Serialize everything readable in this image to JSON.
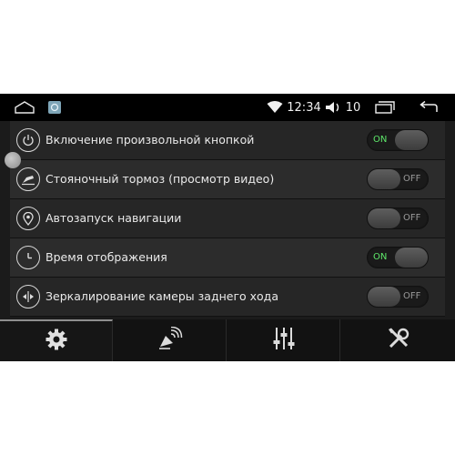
{
  "status_bar": {
    "time": "12:34",
    "volume": "10",
    "icons": [
      "home-outline-icon",
      "app-thumbnail-icon",
      "wifi-icon",
      "volume-icon",
      "recent-apps-icon",
      "back-icon"
    ]
  },
  "settings": [
    {
      "label": "Включение произвольной кнопкой",
      "icon": "power-icon",
      "state": "ON"
    },
    {
      "label": "Стояночный тормоз (просмотр видео)",
      "icon": "parking-brake-icon",
      "state": "OFF"
    },
    {
      "label": "Автозапуск навигации",
      "icon": "location-pin-icon",
      "state": "OFF"
    },
    {
      "label": "Время отображения",
      "icon": "clock-icon",
      "state": "ON"
    },
    {
      "label": "Зеркалирование камеры заднего хода",
      "icon": "mirror-icon",
      "state": "OFF"
    }
  ],
  "tabs": [
    {
      "icon": "gear-icon",
      "active": true
    },
    {
      "icon": "satellite-icon",
      "active": false
    },
    {
      "icon": "equalizer-icon",
      "active": false
    },
    {
      "icon": "tools-icon",
      "active": false
    }
  ],
  "colors": {
    "on_text": "#5ee86a",
    "off_text": "#9a9a9a",
    "background": "#1b1b1b"
  }
}
